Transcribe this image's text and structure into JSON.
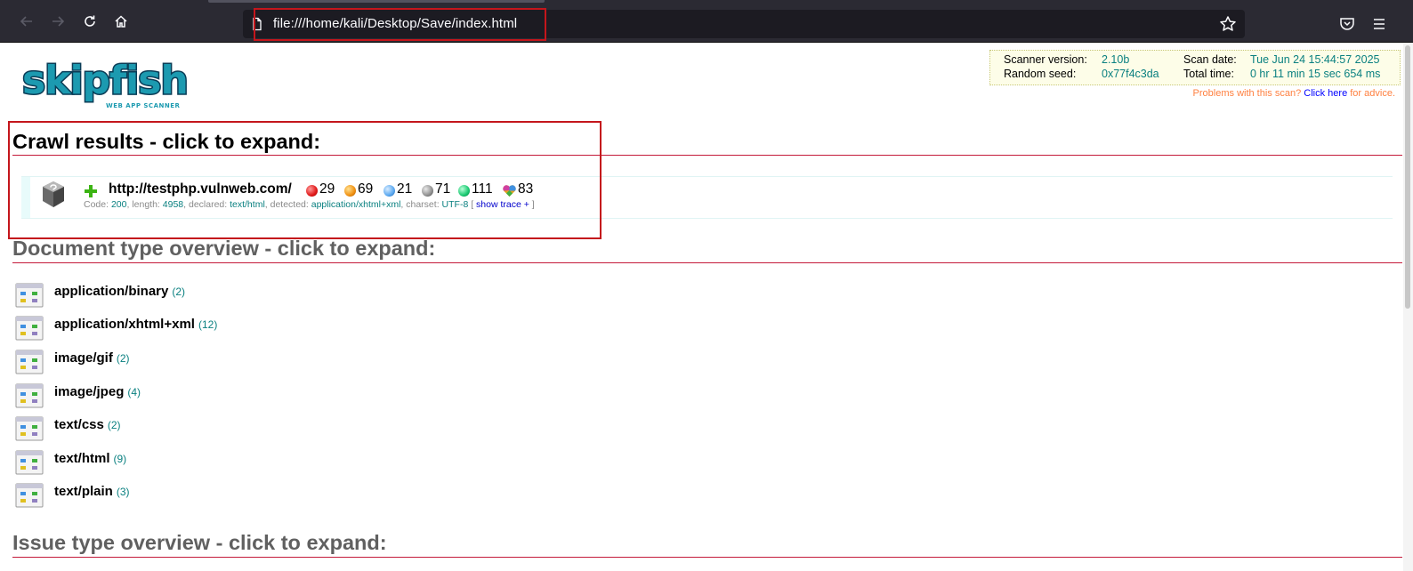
{
  "browser": {
    "url": "file:///home/kali/Desktop/Save/index.html"
  },
  "logo": {
    "title": "skipfish",
    "subtitle": "WEB APP SCANNER"
  },
  "scan_info": {
    "scanner_version_label": "Scanner version:",
    "scanner_version": "2.10b",
    "scan_date_label": "Scan date:",
    "scan_date": "Tue Jun 24 15:44:57 2025",
    "random_seed_label": "Random seed:",
    "random_seed": "0x77f4c3da",
    "total_time_label": "Total time:",
    "total_time": "0 hr 11 min 15 sec 654 ms",
    "problems_text": "Problems with this scan?",
    "problems_link": "Click here",
    "problems_suffix": "for advice."
  },
  "crawl": {
    "heading": "Crawl results - click to expand:",
    "url": "http://testphp.vulnweb.com/",
    "counts": [
      {
        "value": "29",
        "color": "#e01818"
      },
      {
        "value": "69",
        "color": "#f09010"
      },
      {
        "value": "21",
        "color": "#5aa8f0"
      },
      {
        "value": "71",
        "color": "#909090"
      },
      {
        "value": "111",
        "color": "#18c870"
      },
      {
        "value": "83",
        "color": "#d040a0"
      }
    ],
    "meta": {
      "code_label": "Code:",
      "code": "200",
      "length_label": ", length:",
      "length": "4958",
      "declared_label": ", declared:",
      "declared": "text/html",
      "detected_label": ", detected:",
      "detected": "application/xhtml+xml",
      "charset_label": ", charset:",
      "charset": "UTF-8",
      "trace_open": "[",
      "trace": "show trace +",
      "trace_close": "]"
    }
  },
  "doc_types": {
    "heading": "Document type overview - click to expand:",
    "items": [
      {
        "label": "application/binary",
        "count": "(2)"
      },
      {
        "label": "application/xhtml+xml",
        "count": "(12)"
      },
      {
        "label": "image/gif",
        "count": "(2)"
      },
      {
        "label": "image/jpeg",
        "count": "(4)"
      },
      {
        "label": "text/css",
        "count": "(2)"
      },
      {
        "label": "text/html",
        "count": "(9)"
      },
      {
        "label": "text/plain",
        "count": "(3)"
      }
    ]
  },
  "issue_types": {
    "heading": "Issue type overview - click to expand:"
  }
}
